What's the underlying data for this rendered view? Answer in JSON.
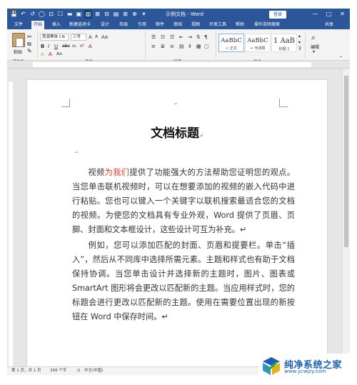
{
  "window": {
    "title": "示例文档 - Word",
    "login": "登录",
    "controls": [
      "—",
      "□",
      "✕"
    ]
  },
  "qat": [
    "💾",
    "↶",
    "↺",
    "◯",
    "⊡",
    "☐",
    "▬",
    "▣",
    "▥",
    "⊠",
    "⊟",
    "▤",
    "⊞",
    "⊕",
    "▾"
  ],
  "tabs": [
    "文件",
    "开始",
    "插入",
    "新建选项卡",
    "设计",
    "布局",
    "引用",
    "邮件",
    "审阅",
    "视图",
    "开发工具",
    "帮助",
    "操作说明搜索",
    "共享"
  ],
  "ribbon": {
    "clipboard": {
      "paste": "粘贴",
      "group": "剪贴板"
    },
    "font": {
      "name": "思源黑体 CN",
      "size": "三号",
      "group": "字体",
      "row2": [
        "B",
        "I",
        "U",
        "abc",
        "x₂",
        "x²",
        "A"
      ],
      "row3": [
        "A",
        "ab",
        "A",
        "Aa",
        "A",
        "A",
        "A"
      ]
    },
    "paragraph": {
      "group": "段落",
      "row1": [
        "☰",
        "☷",
        "☲",
        "⇤",
        "⇥",
        "⇅",
        "¶"
      ],
      "row2": [
        "≡",
        "≣",
        "≡",
        "▤",
        "⇕",
        "▦",
        "▢"
      ]
    },
    "styles": {
      "group": "样式",
      "items": [
        {
          "sample": "AaBbC",
          "name": "↵ 正文"
        },
        {
          "sample": "AaBbC",
          "name": "↵ 无间隔"
        },
        {
          "sample": "1 AaB",
          "name": "标题 1"
        }
      ]
    },
    "editing": {
      "label": "编辑"
    }
  },
  "document": {
    "title": "文档标题",
    "para_mark": "↵",
    "p1_pre": "视频",
    "p1_red": "为我们",
    "p1_post": "提供了功能强大的方法帮助您证明您的观点。当您单击联机视频时，可以在想要添加的视频的嵌入代码中进行粘贴。您也可以键入一个关键字以联机搜索最适合您的文档的视频。为使您的文档具有专业外观，Word 提供了页眉、页脚、封面和文本框设计，这些设计可互为补充。↵",
    "p2": "例如，您可以添加匹配的封面、页眉和提要栏。单击“插入”，然后从不同库中选择所需元素。主题和样式也有助于文档保持协调。当您单击设计并选择新的主题时，图片、图表或 SmartArt 图形将会更改以匹配新的主题。当应用样式时，您的标题会进行更改以匹配新的主题。使用在需要位置出现的新按钮在 Word 中保存时间。↵"
  },
  "status": {
    "page": "第 1 页，共 1 页",
    "words": "268 个字",
    "lang": "中文(中国)",
    "lang_icon": "⊡"
  },
  "watermark": {
    "title": "纯净系统之家",
    "url": "www.ycwjzy.com"
  }
}
